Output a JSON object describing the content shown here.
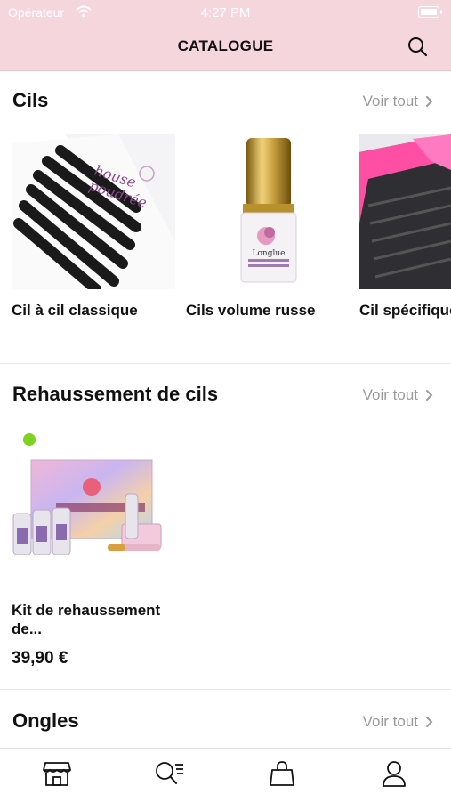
{
  "status_bar": {
    "carrier": "Opérateur",
    "time": "4:27 PM"
  },
  "header": {
    "title": "CATALOGUE",
    "search_icon": "search-icon"
  },
  "sections": [
    {
      "title": "Cils",
      "see_all": "Voir tout",
      "products": [
        {
          "name": "Cil à cil classique"
        },
        {
          "name": "Cils volume russe"
        },
        {
          "name": "Cil spécifique"
        }
      ]
    },
    {
      "title": "Rehaussement de cils",
      "see_all": "Voir tout",
      "products": [
        {
          "name": "Kit de rehaussement de...",
          "price": "39,90 €",
          "badge_color": "#7ed321"
        }
      ]
    },
    {
      "title": "Ongles",
      "see_all": "Voir tout"
    }
  ],
  "tab_bar": {
    "items": [
      {
        "icon": "shop-icon"
      },
      {
        "icon": "search-list-icon"
      },
      {
        "icon": "bag-icon"
      },
      {
        "icon": "profile-icon"
      }
    ]
  },
  "colors": {
    "header_bg": "#f5d6dd",
    "link_gray": "#9a9a9a",
    "badge_green": "#7ed321"
  }
}
